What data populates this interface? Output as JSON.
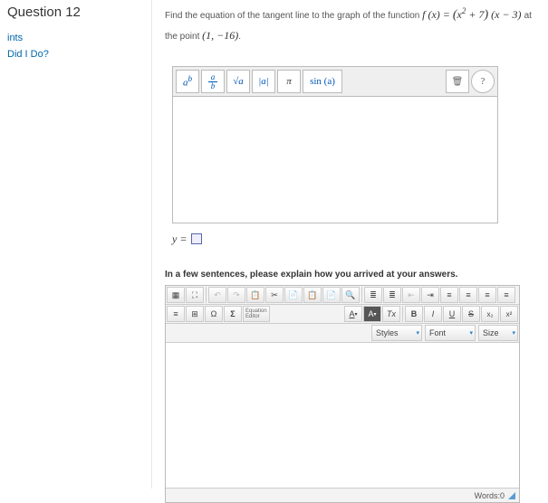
{
  "sidebar": {
    "title": "Question 12",
    "links": [
      "ints",
      "Did I Do?"
    ]
  },
  "prompt": {
    "lead": "Find the equation of the tangent line to the graph of the function ",
    "func_lhs": "f (x) = ",
    "func_rhs_a": "x",
    "func_rhs_exp": "2",
    "func_rhs_b": " + 7",
    "func_rhs_c": "(x − 3)",
    "mid": " at the point ",
    "point": "(1, −16)",
    "trail": "."
  },
  "eq_toolbar": {
    "btn_pow": "a",
    "btn_pow_sup": "b",
    "btn_frac_top": "a",
    "btn_frac_bot": "b",
    "btn_sqrt": "√a",
    "btn_abs": "|a|",
    "btn_pi": "π",
    "btn_sin": "sin (a)",
    "btn_trash": "🗑",
    "btn_help": "?"
  },
  "answer_prefix": "y =",
  "explain_label": "In a few sentences, please explain how you arrived at your answers.",
  "rte": {
    "row1": {
      "source": "▦",
      "maximize": "⛶",
      "undo": "↶",
      "redo": "↷",
      "paste_special": "📋",
      "cut": "✂",
      "copy_paste": "📄",
      "paste_word": "📋",
      "paste_plain": "📄",
      "find": "🔍",
      "ul": "≣",
      "ol": "≣",
      "outdent": "⇤",
      "indent": "⇥",
      "align_l": "≡",
      "align_c": "≡",
      "align_r": "≡",
      "align_j": "≡"
    },
    "row2": {
      "menu": "≡",
      "table": "⊞",
      "omega": "Ω",
      "sigma": "Σ",
      "eq_editor": "Equation\nEditor",
      "fontcolor": "A",
      "bgcolor": "A",
      "removefmt": "Tx",
      "bold": "B",
      "italic": "I",
      "underline": "U",
      "strike": "S",
      "sub": "x₂",
      "sup": "x²",
      "styles": "Styles",
      "font": "Font",
      "size": "Size"
    },
    "status": {
      "words_label": "Words: ",
      "words_count": "0"
    }
  }
}
